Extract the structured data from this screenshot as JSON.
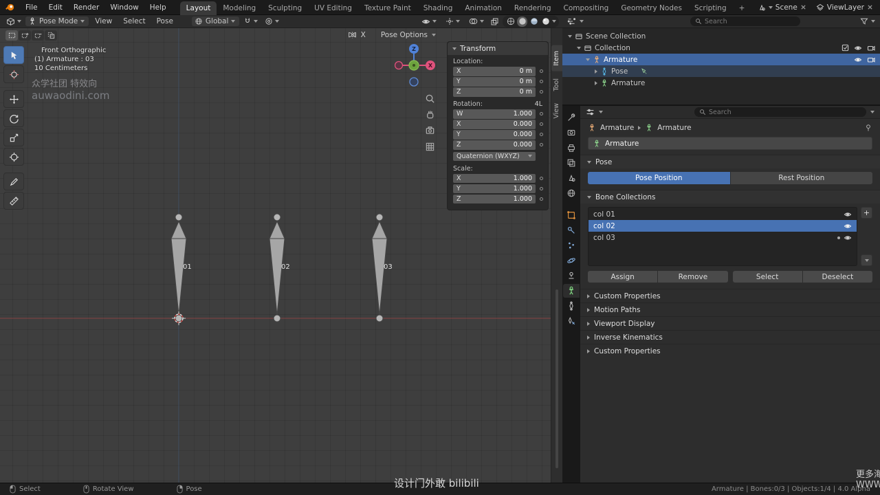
{
  "icons": {
    "plus": "+"
  },
  "topbar": {
    "menus": [
      "File",
      "Edit",
      "Render",
      "Window",
      "Help"
    ],
    "tabs": [
      "Layout",
      "Modeling",
      "Sculpting",
      "UV Editing",
      "Texture Paint",
      "Shading",
      "Animation",
      "Rendering",
      "Compositing",
      "Geometry Nodes",
      "Scripting"
    ],
    "add_tab": "+",
    "scene_name": "Scene",
    "view_layer_name": "ViewLayer"
  },
  "viewport_header": {
    "mode": "Pose Mode",
    "menu_view": "View",
    "menu_select": "Select",
    "menu_pose": "Pose",
    "orientation": "Global"
  },
  "tool_settings": {
    "mirror_label": "X",
    "pose_options_label": "Pose Options"
  },
  "viewport": {
    "view_label": "Front Orthographic",
    "active_label": "(1) Armature : 03",
    "grid_scale": "10 Centimeters",
    "bones": [
      {
        "label": "01"
      },
      {
        "label": "02"
      },
      {
        "label": "03"
      }
    ]
  },
  "n_panel": {
    "tab_item": "Item",
    "tab_tool": "Tool",
    "tab_view": "View",
    "panel_title": "Transform",
    "location_label": "Location:",
    "location": [
      {
        "axis": "X",
        "value": "0 m"
      },
      {
        "axis": "Y",
        "value": "0 m"
      },
      {
        "axis": "Z",
        "value": "0 m"
      }
    ],
    "rotation_label": "Rotation:",
    "rotation_badge": "4L",
    "rotation": [
      {
        "axis": "W",
        "value": "1.000"
      },
      {
        "axis": "X",
        "value": "0.000"
      },
      {
        "axis": "Y",
        "value": "0.000"
      },
      {
        "axis": "Z",
        "value": "0.000"
      }
    ],
    "rotation_mode": "Quaternion (WXYZ)",
    "scale_label": "Scale:",
    "scale": [
      {
        "axis": "X",
        "value": "1.000"
      },
      {
        "axis": "Y",
        "value": "1.000"
      },
      {
        "axis": "Z",
        "value": "1.000"
      }
    ]
  },
  "outliner": {
    "search_placeholder": "Search",
    "rows": [
      {
        "label": "Scene Collection"
      },
      {
        "label": "Collection"
      },
      {
        "label": "Armature"
      },
      {
        "label": "Pose"
      },
      {
        "label": "Armature"
      }
    ]
  },
  "properties": {
    "search_placeholder": "Search",
    "breadcrumb_object": "Armature",
    "breadcrumb_data": "Armature",
    "name_value": "Armature",
    "pose_panel": {
      "title": "Pose",
      "pose_position": "Pose Position",
      "rest_position": "Rest Position"
    },
    "bone_collections": {
      "title": "Bone Collections",
      "items": [
        {
          "name": "col 01"
        },
        {
          "name": "col 02"
        },
        {
          "name": "col 03"
        }
      ],
      "assign": "Assign",
      "remove": "Remove",
      "select": "Select",
      "deselect": "Deselect"
    },
    "collapsed_panels": [
      {
        "title": "Custom Properties"
      },
      {
        "title": "Motion Paths"
      },
      {
        "title": "Viewport Display"
      },
      {
        "title": "Inverse Kinematics"
      },
      {
        "title": "Custom Properties"
      }
    ]
  },
  "statusbar": {
    "hint_left": "Select",
    "hint_middle": "Rotate View",
    "hint_right": "Pose",
    "stats": "Armature | Bones:0/3 | Objects:1/4 | 4.0 Alpha"
  },
  "watermarks": {
    "top_line1": "众学社团 特效向",
    "top_line2": "auwaodini.com",
    "bottom_center": "设计门外敢 bilibili",
    "bottom_right_1": "更多海",
    "bottom_right_2": "WWW"
  },
  "colors": {
    "accent_blue": "#4772b3",
    "selected_row": "#3f65a0",
    "axis_x_red": "#af4646",
    "bone_gray": "#a6a6a6"
  }
}
